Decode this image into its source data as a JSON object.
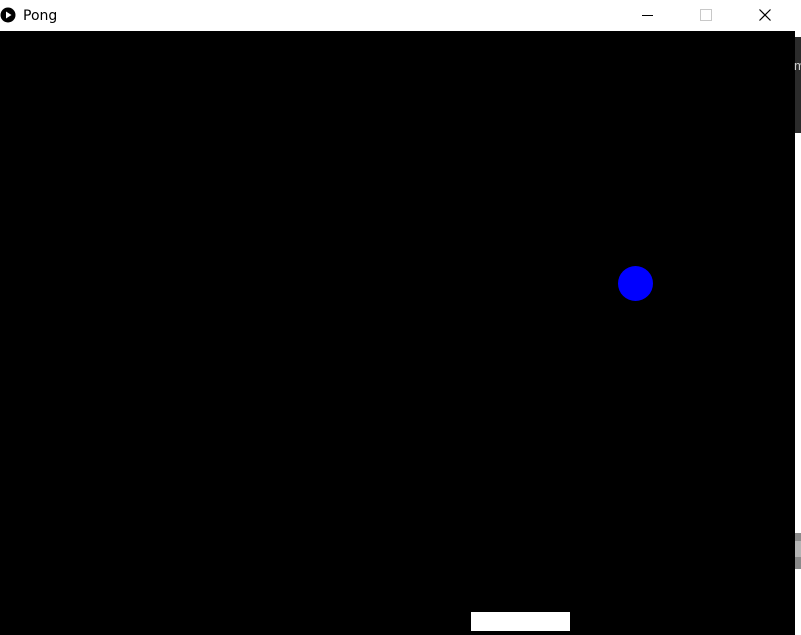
{
  "window": {
    "title": "Pong",
    "icon": "play-circle-icon"
  },
  "controls": {
    "minimize_icon": "minimize-icon",
    "maximize_icon": "maximize-icon",
    "close_icon": "close-icon"
  },
  "game": {
    "background_color": "#000000",
    "ball_color": "#0000ff",
    "paddle_color": "#ffffff"
  },
  "background_window": {
    "partial_text": "m"
  }
}
